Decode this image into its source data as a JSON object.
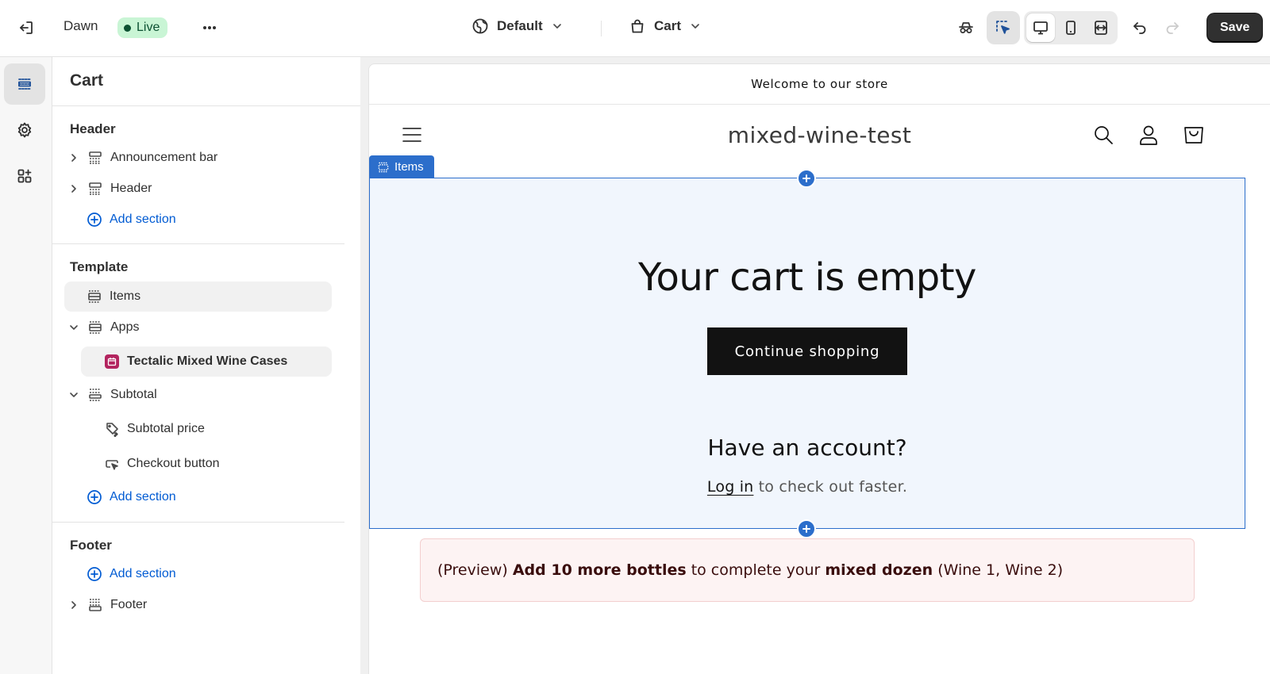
{
  "topbar": {
    "theme_name": "Dawn",
    "live_label": "Live",
    "context_select": "Default",
    "template_select": "Cart",
    "save_label": "Save"
  },
  "sidebar": {
    "title": "Cart",
    "header_group": {
      "title": "Header",
      "items": [
        {
          "label": "Announcement bar"
        },
        {
          "label": "Header"
        }
      ],
      "add_label": "Add section"
    },
    "template_group": {
      "title": "Template",
      "items": {
        "items": "Items",
        "apps": "Apps",
        "app_block": "Tectalic Mixed Wine Cases",
        "subtotal": "Subtotal",
        "subtotal_price": "Subtotal price",
        "checkout_button": "Checkout button"
      },
      "add_label": "Add section"
    },
    "footer_group": {
      "title": "Footer",
      "add_label": "Add section",
      "items": [
        {
          "label": "Footer"
        }
      ]
    }
  },
  "preview": {
    "announcement": "Welcome to our store",
    "store_name": "mixed-wine-test",
    "section_tag": "Items",
    "empty_title": "Your cart is empty",
    "continue_label": "Continue shopping",
    "account_title": "Have an account?",
    "login_link": "Log in",
    "login_rest": " to check out faster.",
    "banner": {
      "prefix": "(Preview) ",
      "bold1": "Add 10 more bottles",
      "mid": " to complete your ",
      "bold2": "mixed dozen",
      "suffix": " (Wine 1, Wine 2)"
    }
  },
  "colors": {
    "accent": "#005bd3",
    "section_highlight": "#2c6ecb",
    "live_badge_bg": "#c9f5d5",
    "banner_bg": "#fdf3f3",
    "button_dark": "#121212"
  }
}
